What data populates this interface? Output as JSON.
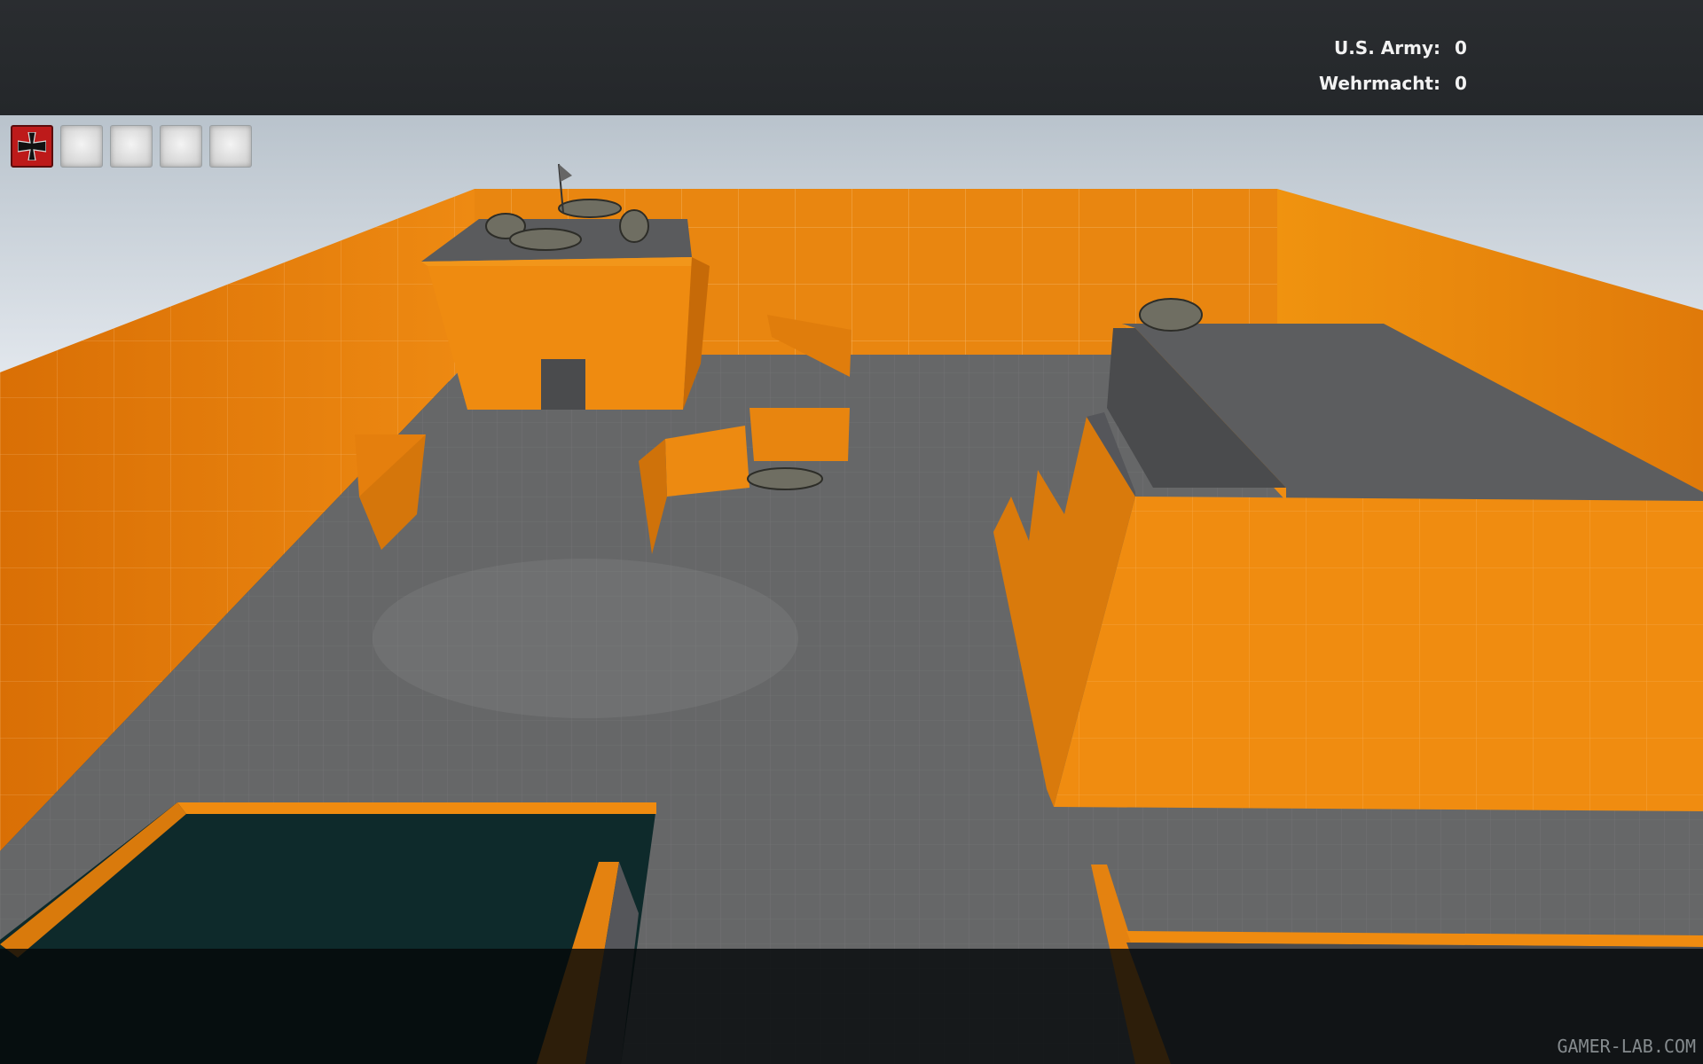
{
  "scoreboard": {
    "teams": [
      {
        "name": "U.S. Army:",
        "score": "0"
      },
      {
        "name": "Wehrmacht:",
        "score": "0"
      }
    ]
  },
  "flags": [
    {
      "owner": "wehrmacht",
      "icon": "iron-cross-icon"
    },
    {
      "owner": "neutral",
      "icon": "neutral-flag-icon"
    },
    {
      "owner": "neutral",
      "icon": "neutral-flag-icon"
    },
    {
      "owner": "neutral",
      "icon": "neutral-flag-icon"
    },
    {
      "owner": "neutral",
      "icon": "neutral-flag-icon"
    }
  ],
  "colors": {
    "wall_orange": "#e8820e",
    "floor_gray": "#6b6b6b",
    "water": "#0f2a2b",
    "sky": "#d6dde4",
    "axis_red": "#bd1a1a"
  },
  "watermark": "GAMER-LAB.COM"
}
